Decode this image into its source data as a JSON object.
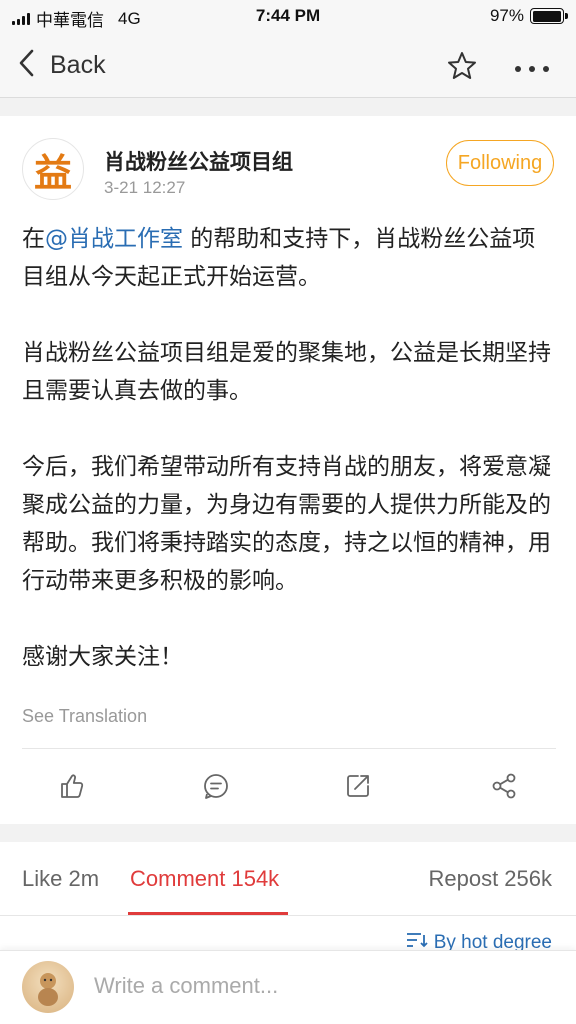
{
  "status_bar": {
    "carrier": "中華電信",
    "network": "4G",
    "time": "7:44 PM",
    "battery": "97%",
    "battery_level": 0.97
  },
  "nav": {
    "back_label": "Back",
    "star_icon": "star-outline-icon",
    "more_icon": "more-dots-icon"
  },
  "post": {
    "avatar_glyph": "益",
    "author": "肖战粉丝公益项目组",
    "time": "3-21 12:27",
    "follow_label": "Following",
    "paragraphs": [
      {
        "before": "在",
        "mention": "@肖战工作室",
        "after": " 的帮助和支持下，肖战粉丝公益项目组从今天起正式开始运营。"
      },
      {
        "text": "肖战粉丝公益项目组是爱的聚集地，公益是长期坚持且需要认真去做的事。"
      },
      {
        "text": "今后，我们希望带动所有支持肖战的朋友，将爱意凝聚成公益的力量，为身边有需要的人提供力所能及的帮助。我们将秉持踏实的态度，持之以恒的精神，用行动带来更多积极的影响。"
      },
      {
        "text": "感谢大家关注！"
      }
    ],
    "see_translation": "See Translation",
    "actions": [
      "like-icon",
      "comment-icon",
      "repost-icon",
      "share-icon"
    ]
  },
  "tabs": {
    "like": "Like 2m",
    "comment": "Comment 154k",
    "repost": "Repost 256k",
    "sort": "By hot degree"
  },
  "comment_bar": {
    "placeholder": "Write a comment..."
  },
  "colors": {
    "accent": "#e03b3b",
    "follow": "#f5a623",
    "link": "#2a6db3"
  }
}
